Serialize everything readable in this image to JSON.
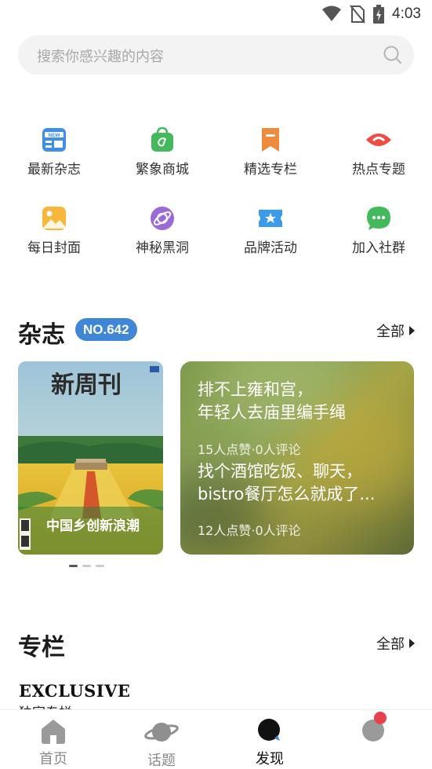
{
  "status_bar": {
    "time": "4:03",
    "icons": [
      "wifi-icon",
      "no-sim-icon",
      "battery-charging-icon"
    ]
  },
  "search": {
    "placeholder": "搜索你感兴趣的内容",
    "icon": "search-icon"
  },
  "quick_grid": [
    {
      "label": "最新杂志",
      "icon": "new-magazine-icon",
      "color": "#3f8fe8"
    },
    {
      "label": "繁象商城",
      "icon": "shopping-bag-icon",
      "color": "#43b95c"
    },
    {
      "label": "精选专栏",
      "icon": "bookmark-icon",
      "color": "#f08a3c"
    },
    {
      "label": "热点专题",
      "icon": "eye-icon",
      "color": "#ee4d43"
    },
    {
      "label": "每日封面",
      "icon": "picture-icon",
      "color": "#f6b73a"
    },
    {
      "label": "神秘黑洞",
      "icon": "planet-icon",
      "color": "#9a6ad8"
    },
    {
      "label": "品牌活动",
      "icon": "ticket-icon",
      "color": "#3c9be8"
    },
    {
      "label": "加入社群",
      "icon": "chat-icon",
      "color": "#43b95c"
    }
  ],
  "magazine": {
    "title": "杂志",
    "issue": "NO.642",
    "more": "全部",
    "cover": {
      "masthead": "新周刊",
      "headline": "中国乡创新浪潮"
    },
    "carousel_count": 3,
    "carousel_active": 0,
    "articles": [
      {
        "title_line1": "排不上雍和宫，",
        "title_line2": "年轻人去庙里编手绳",
        "meta": "15人点赞·0人评论"
      },
      {
        "title_line1": "找个酒馆吃饭、聊天，",
        "title_line2": "bistro餐厅怎么就成了...",
        "meta": "12人点赞·0人评论"
      }
    ]
  },
  "column": {
    "title": "专栏",
    "more": "全部",
    "brand_en": "EXCLUSIVE",
    "brand_cn": "独家专栏"
  },
  "tabbar": {
    "tabs": [
      {
        "label": "首页",
        "icon": "home-icon"
      },
      {
        "label": "话题",
        "icon": "saturn-icon"
      },
      {
        "label": "发现",
        "icon": "discover-icon",
        "active": true
      },
      {
        "label": "",
        "icon": "profile-icon"
      }
    ],
    "accent": "#111111",
    "inactive": "#8a8a8a",
    "notification_color": "#e5424d"
  }
}
